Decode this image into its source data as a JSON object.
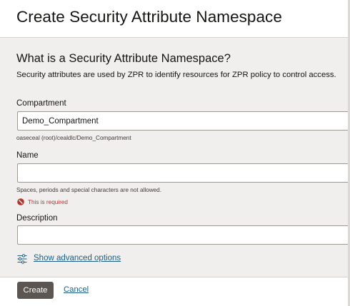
{
  "dialog": {
    "title": "Create Security Attribute Namespace"
  },
  "info": {
    "heading": "What is a Security Attribute Namespace?",
    "description": "Security attributes are used by ZPR to identify resources for ZPR policy to control access."
  },
  "form": {
    "compartment": {
      "label": "Compartment",
      "value": "Demo_Compartment",
      "path": "oaseceal (root)/cealdlc/Demo_Compartment"
    },
    "name": {
      "label": "Name",
      "value": "",
      "hint": "Spaces, periods and special characters are not allowed.",
      "error": "This is required"
    },
    "description": {
      "label": "Description",
      "value": ""
    },
    "advanced_link": "Show advanced options"
  },
  "footer": {
    "create_label": "Create",
    "cancel_label": "Cancel"
  },
  "colors": {
    "primary_button": "#5b5652",
    "link": "#1c5f86",
    "error": "#b2352b",
    "panel_bg": "#f1efed"
  },
  "icons": {
    "error": "prohibited-icon",
    "advanced": "sliders-icon"
  }
}
